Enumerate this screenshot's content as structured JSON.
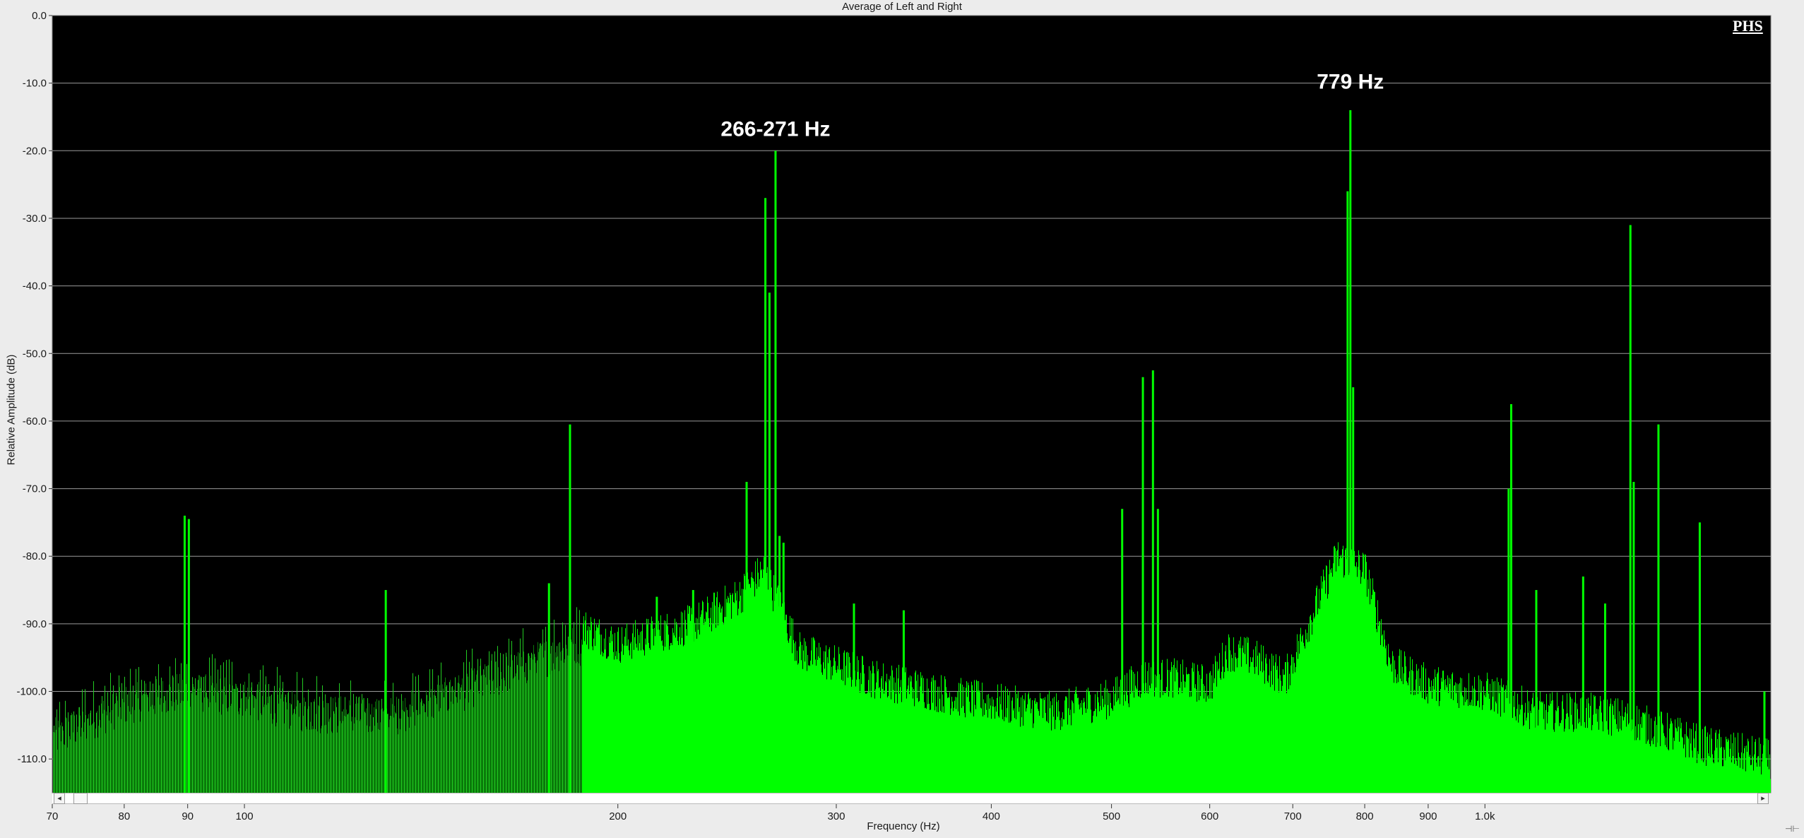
{
  "chart_data": {
    "type": "bar",
    "title": "Average of Left and Right",
    "xlabel": "Frequency (Hz)",
    "ylabel": "Relative Amplitude (dB)",
    "x_scale": "log",
    "xlim": [
      70,
      1700
    ],
    "ylim": [
      -115,
      0
    ],
    "grid": true,
    "y_ticks": [
      0,
      -10,
      -20,
      -30,
      -40,
      -50,
      -60,
      -70,
      -80,
      -90,
      -100,
      -110
    ],
    "y_tick_labels": [
      "0.0",
      "-10.0",
      "-20.0",
      "-30.0",
      "-40.0",
      "-50.0",
      "-60.0",
      "-70.0",
      "-80.0",
      "-90.0",
      "-100.0",
      "-110.0"
    ],
    "x_ticks": [
      70,
      80,
      90,
      100,
      200,
      300,
      400,
      500,
      600,
      700,
      800,
      900,
      1000
    ],
    "x_tick_labels": [
      "70",
      "80",
      "90",
      "100",
      "200",
      "300",
      "400",
      "500",
      "600",
      "700",
      "800",
      "900",
      "1.0k"
    ],
    "series": [
      {
        "color": "#00ff00",
        "floor": [
          [
            70,
            -104
          ],
          [
            80,
            -99
          ],
          [
            90,
            -97
          ],
          [
            100,
            -98
          ],
          [
            110,
            -100
          ],
          [
            130,
            -101
          ],
          [
            150,
            -97
          ],
          [
            170,
            -93
          ],
          [
            185,
            -90
          ],
          [
            200,
            -93
          ],
          [
            230,
            -90
          ],
          [
            250,
            -86
          ],
          [
            262,
            -82
          ],
          [
            280,
            -94
          ],
          [
            320,
            -98
          ],
          [
            380,
            -101
          ],
          [
            450,
            -103
          ],
          [
            500,
            -101
          ],
          [
            530,
            -98
          ],
          [
            560,
            -98
          ],
          [
            600,
            -99
          ],
          [
            620,
            -94
          ],
          [
            650,
            -95
          ],
          [
            690,
            -98
          ],
          [
            720,
            -90
          ],
          [
            760,
            -80
          ],
          [
            800,
            -82
          ],
          [
            840,
            -96
          ],
          [
            900,
            -99
          ],
          [
            1000,
            -100
          ],
          [
            1100,
            -103
          ],
          [
            1200,
            -103
          ],
          [
            1300,
            -104
          ],
          [
            1400,
            -106
          ],
          [
            1500,
            -108
          ],
          [
            1700,
            -110
          ]
        ],
        "peaks": [
          [
            89.5,
            -74
          ],
          [
            90.2,
            -74.5
          ],
          [
            130,
            -85
          ],
          [
            183,
            -60.5
          ],
          [
            263,
            -27
          ],
          [
            265,
            -41
          ],
          [
            268,
            -20
          ],
          [
            272,
            -78
          ],
          [
            270,
            -77
          ],
          [
            176,
            -84
          ],
          [
            215,
            -86
          ],
          [
            230,
            -85
          ],
          [
            254,
            -69
          ],
          [
            310,
            -87
          ],
          [
            340,
            -88
          ],
          [
            510,
            -73
          ],
          [
            530,
            -53.5
          ],
          [
            540,
            -52.5
          ],
          [
            545,
            -73
          ],
          [
            775,
            -26
          ],
          [
            779,
            -14
          ],
          [
            783,
            -55
          ],
          [
            1050,
            -57.5
          ],
          [
            1045,
            -70
          ],
          [
            1100,
            -85
          ],
          [
            1200,
            -83
          ],
          [
            1250,
            -87
          ],
          [
            1310,
            -31
          ],
          [
            1318,
            -69
          ],
          [
            1380,
            -60.5
          ],
          [
            1490,
            -75
          ],
          [
            1680,
            -100
          ]
        ]
      }
    ]
  },
  "annotations": [
    {
      "text": "266-271 Hz",
      "freq": 268,
      "db": -17
    },
    {
      "text": "779 Hz",
      "freq": 779,
      "db": -10
    }
  ],
  "watermark": "PHS",
  "scrollbar": {
    "left_arrow": "◂",
    "right_arrow": "▸"
  },
  "corner": "⊣⊢"
}
